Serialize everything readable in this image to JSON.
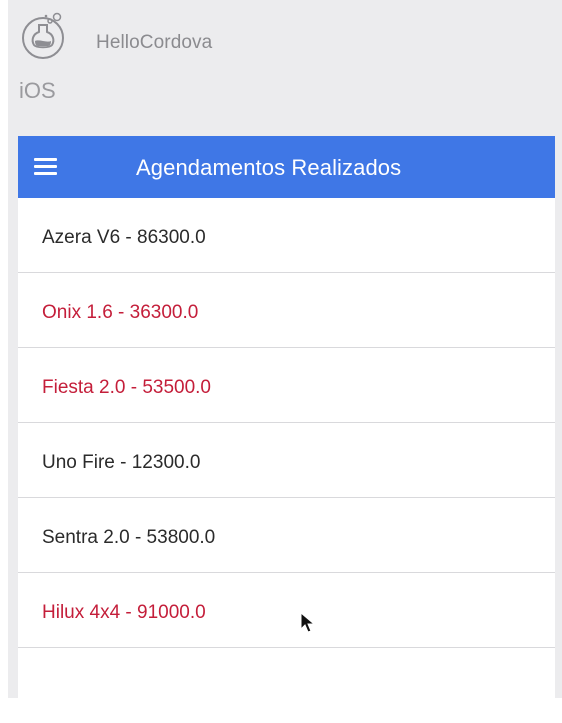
{
  "app": {
    "name": "HelloCordova",
    "platform": "iOS",
    "icon": "flask-icon"
  },
  "toolbar": {
    "title": "Agendamentos Realizados",
    "menu_icon": "hamburger-icon",
    "color": "#3f77e6"
  },
  "list": {
    "items": [
      {
        "label": "Azera V6 - 86300.0",
        "highlighted": false
      },
      {
        "label": "Onix 1.6 - 36300.0",
        "highlighted": true
      },
      {
        "label": "Fiesta 2.0 - 53500.0",
        "highlighted": true
      },
      {
        "label": "Uno Fire - 12300.0",
        "highlighted": false
      },
      {
        "label": "Sentra 2.0 - 53800.0",
        "highlighted": false
      },
      {
        "label": "Hilux 4x4 - 91000.0",
        "highlighted": true
      }
    ],
    "normal_color": "#2b2b2b",
    "highlight_color": "#c41e3a"
  }
}
